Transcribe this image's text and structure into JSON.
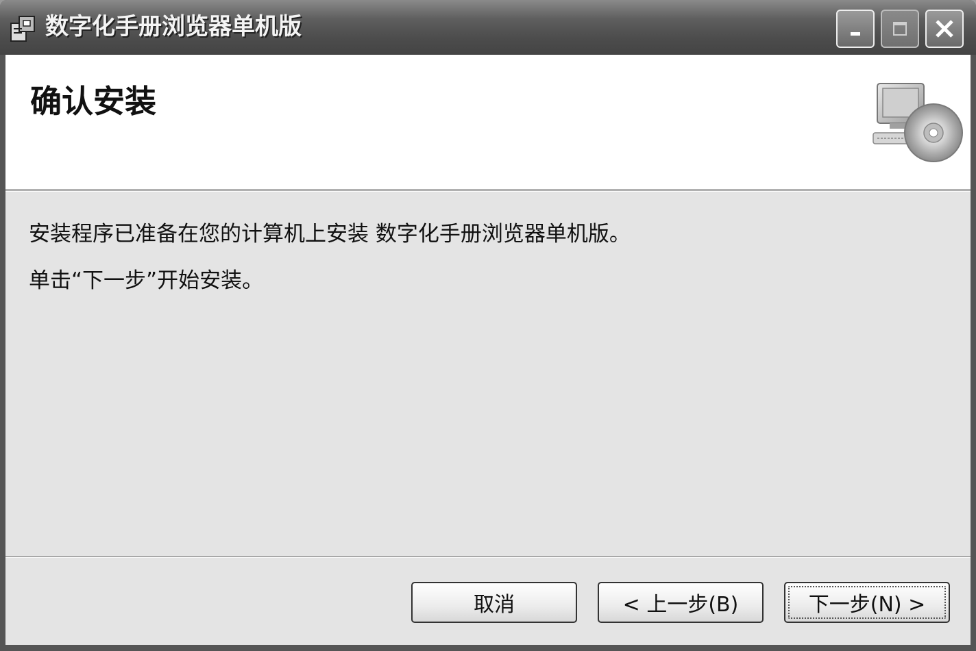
{
  "window": {
    "title": "数字化手册浏览器单机版",
    "controls": {
      "minimize_icon": "minimize-icon",
      "maximize_icon": "maximize-icon",
      "close_icon": "close-icon"
    }
  },
  "header": {
    "title": "确认安装",
    "icon": "computer-cd-icon"
  },
  "body": {
    "message_ready": "安装程序已准备在您的计算机上安装 数字化手册浏览器单机版。",
    "message_click_next": "单击“下一步”开始安装。"
  },
  "buttons": {
    "cancel": "取消",
    "back": "< 上一步(B)",
    "next": "下一步(N) >"
  }
}
